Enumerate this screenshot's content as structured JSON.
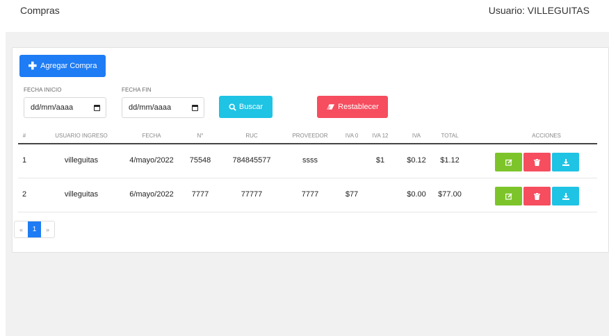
{
  "header": {
    "title": "Compras",
    "user": "Usuario: VILLEGUITAS"
  },
  "toolbar": {
    "add_label": "Agregar Compra",
    "fecha_inicio_label": "FECHA INICIO",
    "fecha_inicio_placeholder": "dd/mm/aaaa",
    "fecha_fin_label": "FECHA FIN",
    "fecha_fin_placeholder": "dd/mm/aaaa",
    "search_label": "Buscar",
    "reset_label": "Restablecer"
  },
  "table": {
    "headers": [
      "#",
      "USUARIO INGRESO",
      "FECHA",
      "N°",
      "RUC",
      "PROVEEDOR",
      "IVA 0",
      "IVA 12",
      "IVA",
      "TOTAL",
      "ACCIONES"
    ],
    "rows": [
      {
        "num": "1",
        "usuario": "villeguitas",
        "fecha": "4/mayo/2022",
        "n": "75548",
        "ruc": "784845577",
        "proveedor": "ssss",
        "iva0": "",
        "iva12": "$1",
        "iva": "$0.12",
        "total": "$1.12"
      },
      {
        "num": "2",
        "usuario": "villeguitas",
        "fecha": "6/mayo/2022",
        "n": "7777",
        "ruc": "77777",
        "proveedor": "7777",
        "iva0": "$77",
        "iva12": "",
        "iva": "$0.00",
        "total": "$77.00"
      }
    ]
  },
  "pagination": {
    "prev": "«",
    "current": "1",
    "next": "»"
  },
  "colors": {
    "primary": "#1e7cf4",
    "info": "#1fc3e4",
    "danger": "#f64d5f",
    "success": "#7dc42a"
  },
  "icons": {
    "add": "plus-icon",
    "search": "search-icon",
    "reset": "eraser-icon",
    "edit": "edit-icon",
    "delete": "trash-icon",
    "download": "download-icon",
    "calendar": "calendar-icon"
  }
}
